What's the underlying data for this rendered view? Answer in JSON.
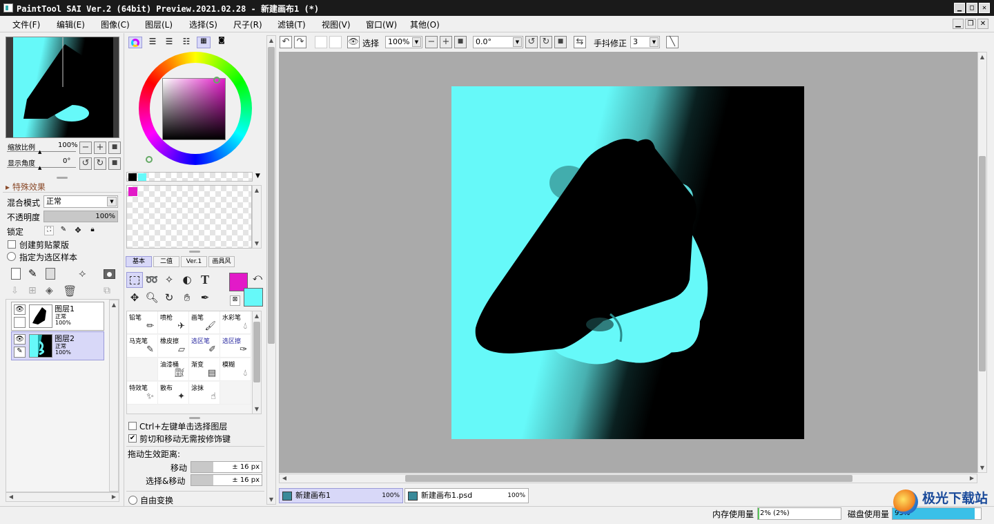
{
  "window": {
    "title": "PaintTool SAI Ver.2 (64bit) Preview.2021.02.28 - 新建画布1 (*)"
  },
  "menu": [
    "文件(F)",
    "编辑(E)",
    "图像(C)",
    "图层(L)",
    "选择(S)",
    "尺子(R)",
    "滤镜(T)",
    "视图(V)",
    "窗口(W)",
    "其他(O)"
  ],
  "navigator": {
    "zoom_label": "缩放比例",
    "zoom_value": "100%",
    "angle_label": "显示角度",
    "angle_value": "0°"
  },
  "layer_props": {
    "effects_label": "特殊效果",
    "blend_label": "混合模式",
    "blend_value": "正常",
    "opacity_label": "不透明度",
    "opacity_value": "100%",
    "opacity_fraction": 1.0,
    "lock_label": "锁定",
    "clip_label": "创建剪贴蒙版",
    "selection_source_label": "指定为选区样本"
  },
  "layers": [
    {
      "name": "图层1",
      "mode": "正常",
      "opacity": "100%",
      "selected": false
    },
    {
      "name": "图层2",
      "mode": "正常",
      "opacity": "100%",
      "selected": true
    }
  ],
  "colors": {
    "primary": "#e21ac8",
    "secondary": "#66f9f9",
    "canvas_bg": "#aaaaaa",
    "accent_layer_bg": "#d8d8f8"
  },
  "tool_tabs": [
    "基本",
    "二值",
    "Ver.1",
    "画具风"
  ],
  "brushes": [
    {
      "name": "铅笔",
      "icon": "pencil-icon"
    },
    {
      "name": "喷枪",
      "icon": "airbrush-icon"
    },
    {
      "name": "画笔",
      "icon": "brush-icon"
    },
    {
      "name": "水彩笔",
      "icon": "watercolor-icon"
    },
    {
      "name": "马克笔",
      "icon": "marker-icon"
    },
    {
      "name": "橡皮擦",
      "icon": "eraser-icon"
    },
    {
      "name": "选区笔",
      "icon": "select-pen-icon"
    },
    {
      "name": "选区擦",
      "icon": "select-eraser-icon"
    },
    {
      "name": "",
      "icon": ""
    },
    {
      "name": "油漆桶",
      "icon": "bucket-icon"
    },
    {
      "name": "渐变",
      "icon": "gradient-icon"
    },
    {
      "name": "模糊",
      "icon": "blur-icon"
    },
    {
      "name": "特效笔",
      "icon": "effect-pen-icon"
    },
    {
      "name": "散布",
      "icon": "scatter-icon"
    },
    {
      "name": "涂抹",
      "icon": "smudge-icon"
    },
    {
      "name": "",
      "icon": ""
    }
  ],
  "move_options": {
    "ctrl_click_label": "Ctrl+左键单击选择图层",
    "no_modifier_label": "剪切和移动无需按修饰键",
    "drag_distance_label": "拖动生效距离:",
    "move_label": "移动",
    "move_value": "± 16 px",
    "select_move_label": "选择&移动",
    "select_move_value": "± 16 px",
    "free_transform_label": "自由变换"
  },
  "toolbar": {
    "select_label": "选择",
    "zoom": "100%",
    "angle": "0.0°",
    "stabilizer_label": "手抖修正",
    "stabilizer_value": "3"
  },
  "doc_tabs": [
    {
      "name": "新建画布1",
      "zoom": "100%",
      "active": true
    },
    {
      "name": "新建画布1.psd",
      "zoom": "100%",
      "active": false
    }
  ],
  "status": {
    "memory_label": "内存使用量",
    "memory_value": "2% (2%)",
    "memory_fraction": 0.02,
    "disk_label": "磁盘使用量",
    "disk_value": "93%",
    "disk_fraction": 0.93
  },
  "watermark": "极光下载站"
}
